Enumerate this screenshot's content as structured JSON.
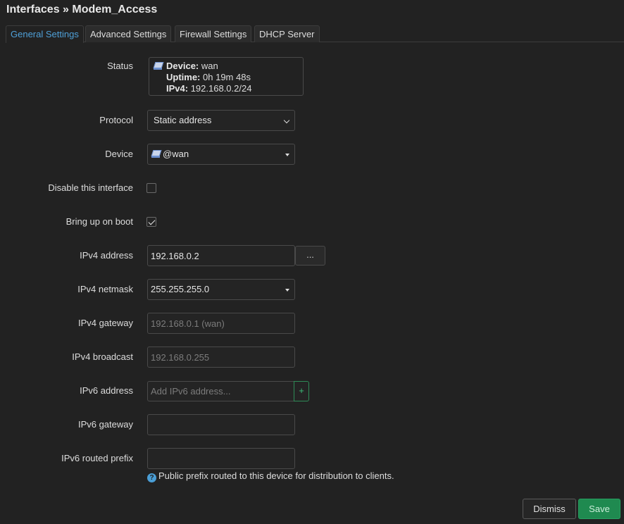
{
  "page": {
    "title": "Interfaces » Modem_Access"
  },
  "tabs": [
    {
      "label": "General Settings",
      "active": true
    },
    {
      "label": "Advanced Settings",
      "active": false
    },
    {
      "label": "Firewall Settings",
      "active": false
    },
    {
      "label": "DHCP Server",
      "active": false
    }
  ],
  "status": {
    "label": "Status",
    "device_key": "Device:",
    "device_val": "wan",
    "uptime_key": "Uptime:",
    "uptime_val": "0h 19m 48s",
    "ipv4_key": "IPv4:",
    "ipv4_val": "192.168.0.2/24",
    "icon": "network-device-icon"
  },
  "protocol": {
    "label": "Protocol",
    "value": "Static address"
  },
  "device": {
    "label": "Device",
    "value": "@wan",
    "icon": "network-device-icon"
  },
  "disable_interface": {
    "label": "Disable this interface",
    "checked": false
  },
  "bring_up_on_boot": {
    "label": "Bring up on boot",
    "checked": true
  },
  "ipv4_address": {
    "label": "IPv4 address",
    "value": "192.168.0.2",
    "more_label": "..."
  },
  "ipv4_netmask": {
    "label": "IPv4 netmask",
    "value": "255.255.255.0"
  },
  "ipv4_gateway": {
    "label": "IPv4 gateway",
    "placeholder": "192.168.0.1 (wan)"
  },
  "ipv4_broadcast": {
    "label": "IPv4 broadcast",
    "placeholder": "192.168.0.255"
  },
  "ipv6_address": {
    "label": "IPv6 address",
    "placeholder": "Add IPv6 address...",
    "add_label": "+"
  },
  "ipv6_gateway": {
    "label": "IPv6 gateway",
    "value": ""
  },
  "ipv6_routed_prefix": {
    "label": "IPv6 routed prefix",
    "value": "",
    "hint": "Public prefix routed to this device for distribution to clients.",
    "hint_icon": "?"
  },
  "footer": {
    "dismiss_label": "Dismiss",
    "save_label": "Save"
  },
  "colors": {
    "background": "#222222",
    "active_tab": "#4fa0d8",
    "save": "#1f8a50",
    "add": "#3cbf7a"
  }
}
